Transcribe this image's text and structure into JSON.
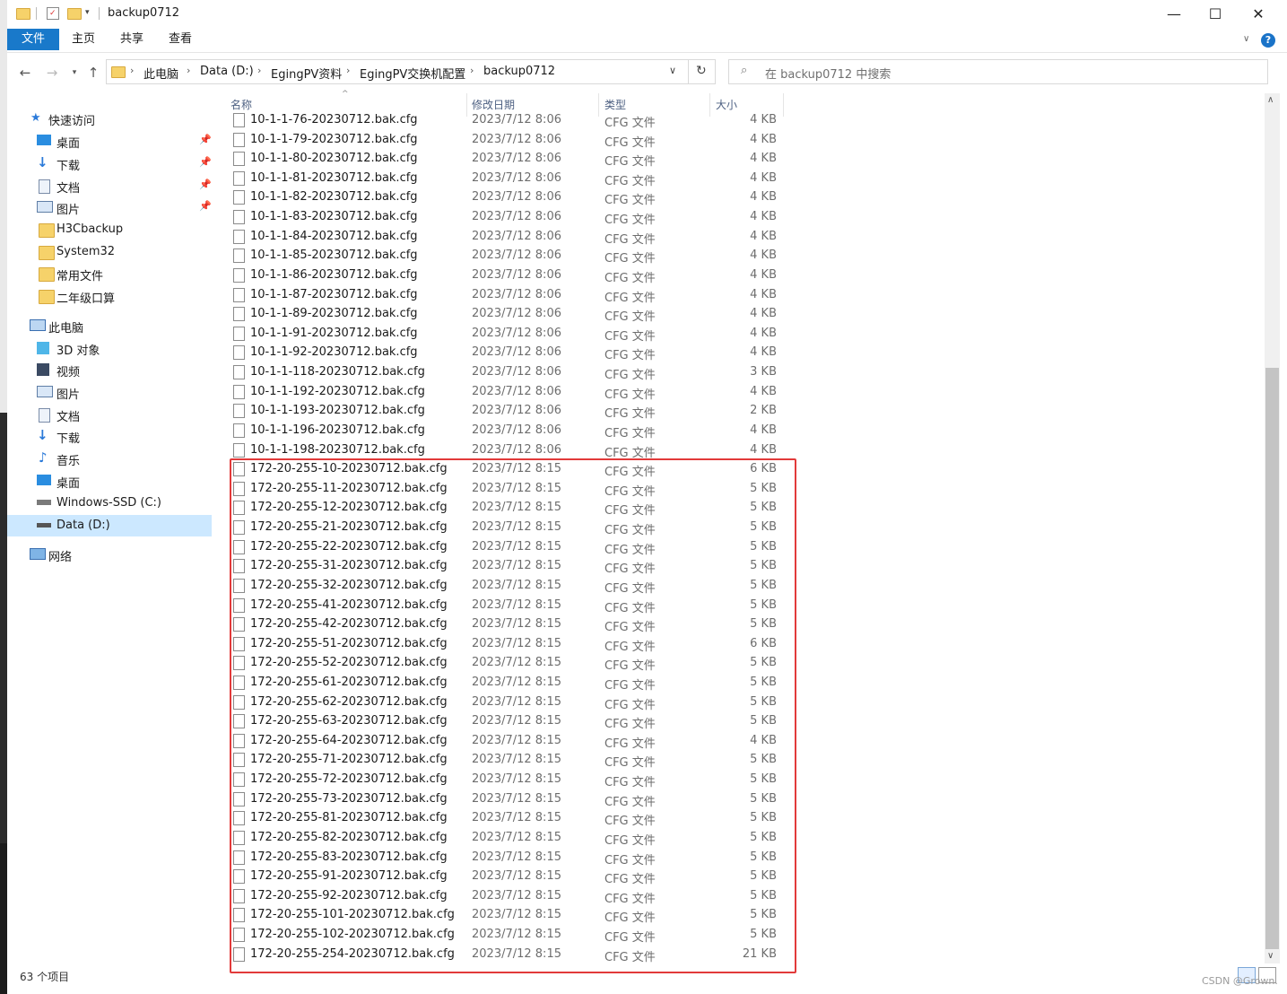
{
  "window": {
    "title": "backup0712",
    "controls": {
      "minimize": "—",
      "maximize": "☐",
      "close": "✕"
    }
  },
  "ribbon": {
    "tabs": [
      "文件",
      "主页",
      "共享",
      "查看"
    ],
    "help": "?"
  },
  "address": {
    "breadcrumb": [
      "此电脑",
      "Data (D:)",
      "EgingPV资料",
      "EgingPV交换机配置",
      "backup0712"
    ],
    "search_placeholder": "在 backup0712 中搜索"
  },
  "nav": {
    "quick_access": "快速访问",
    "quick_items": [
      "桌面",
      "下载",
      "文档",
      "图片",
      "H3Cbackup",
      "System32",
      "常用文件",
      "二年级口算"
    ],
    "this_pc": "此电脑",
    "pc_items": [
      "3D 对象",
      "视频",
      "图片",
      "文档",
      "下载",
      "音乐",
      "桌面",
      "Windows-SSD (C:)",
      "Data (D:)"
    ],
    "network": "网络",
    "selected": "Data (D:)"
  },
  "columns": {
    "name": "名称",
    "date": "修改日期",
    "type": "类型",
    "size": "大小"
  },
  "files": [
    {
      "name": "10-1-1-76-20230712.bak.cfg",
      "date": "2023/7/12 8:06",
      "type": "CFG 文件",
      "size": "4 KB"
    },
    {
      "name": "10-1-1-79-20230712.bak.cfg",
      "date": "2023/7/12 8:06",
      "type": "CFG 文件",
      "size": "4 KB"
    },
    {
      "name": "10-1-1-80-20230712.bak.cfg",
      "date": "2023/7/12 8:06",
      "type": "CFG 文件",
      "size": "4 KB"
    },
    {
      "name": "10-1-1-81-20230712.bak.cfg",
      "date": "2023/7/12 8:06",
      "type": "CFG 文件",
      "size": "4 KB"
    },
    {
      "name": "10-1-1-82-20230712.bak.cfg",
      "date": "2023/7/12 8:06",
      "type": "CFG 文件",
      "size": "4 KB"
    },
    {
      "name": "10-1-1-83-20230712.bak.cfg",
      "date": "2023/7/12 8:06",
      "type": "CFG 文件",
      "size": "4 KB"
    },
    {
      "name": "10-1-1-84-20230712.bak.cfg",
      "date": "2023/7/12 8:06",
      "type": "CFG 文件",
      "size": "4 KB"
    },
    {
      "name": "10-1-1-85-20230712.bak.cfg",
      "date": "2023/7/12 8:06",
      "type": "CFG 文件",
      "size": "4 KB"
    },
    {
      "name": "10-1-1-86-20230712.bak.cfg",
      "date": "2023/7/12 8:06",
      "type": "CFG 文件",
      "size": "4 KB"
    },
    {
      "name": "10-1-1-87-20230712.bak.cfg",
      "date": "2023/7/12 8:06",
      "type": "CFG 文件",
      "size": "4 KB"
    },
    {
      "name": "10-1-1-89-20230712.bak.cfg",
      "date": "2023/7/12 8:06",
      "type": "CFG 文件",
      "size": "4 KB"
    },
    {
      "name": "10-1-1-91-20230712.bak.cfg",
      "date": "2023/7/12 8:06",
      "type": "CFG 文件",
      "size": "4 KB"
    },
    {
      "name": "10-1-1-92-20230712.bak.cfg",
      "date": "2023/7/12 8:06",
      "type": "CFG 文件",
      "size": "4 KB"
    },
    {
      "name": "10-1-1-118-20230712.bak.cfg",
      "date": "2023/7/12 8:06",
      "type": "CFG 文件",
      "size": "3 KB"
    },
    {
      "name": "10-1-1-192-20230712.bak.cfg",
      "date": "2023/7/12 8:06",
      "type": "CFG 文件",
      "size": "4 KB"
    },
    {
      "name": "10-1-1-193-20230712.bak.cfg",
      "date": "2023/7/12 8:06",
      "type": "CFG 文件",
      "size": "2 KB"
    },
    {
      "name": "10-1-1-196-20230712.bak.cfg",
      "date": "2023/7/12 8:06",
      "type": "CFG 文件",
      "size": "4 KB"
    },
    {
      "name": "10-1-1-198-20230712.bak.cfg",
      "date": "2023/7/12 8:06",
      "type": "CFG 文件",
      "size": "4 KB"
    },
    {
      "name": "172-20-255-10-20230712.bak.cfg",
      "date": "2023/7/12 8:15",
      "type": "CFG 文件",
      "size": "6 KB"
    },
    {
      "name": "172-20-255-11-20230712.bak.cfg",
      "date": "2023/7/12 8:15",
      "type": "CFG 文件",
      "size": "5 KB"
    },
    {
      "name": "172-20-255-12-20230712.bak.cfg",
      "date": "2023/7/12 8:15",
      "type": "CFG 文件",
      "size": "5 KB"
    },
    {
      "name": "172-20-255-21-20230712.bak.cfg",
      "date": "2023/7/12 8:15",
      "type": "CFG 文件",
      "size": "5 KB"
    },
    {
      "name": "172-20-255-22-20230712.bak.cfg",
      "date": "2023/7/12 8:15",
      "type": "CFG 文件",
      "size": "5 KB"
    },
    {
      "name": "172-20-255-31-20230712.bak.cfg",
      "date": "2023/7/12 8:15",
      "type": "CFG 文件",
      "size": "5 KB"
    },
    {
      "name": "172-20-255-32-20230712.bak.cfg",
      "date": "2023/7/12 8:15",
      "type": "CFG 文件",
      "size": "5 KB"
    },
    {
      "name": "172-20-255-41-20230712.bak.cfg",
      "date": "2023/7/12 8:15",
      "type": "CFG 文件",
      "size": "5 KB"
    },
    {
      "name": "172-20-255-42-20230712.bak.cfg",
      "date": "2023/7/12 8:15",
      "type": "CFG 文件",
      "size": "5 KB"
    },
    {
      "name": "172-20-255-51-20230712.bak.cfg",
      "date": "2023/7/12 8:15",
      "type": "CFG 文件",
      "size": "6 KB"
    },
    {
      "name": "172-20-255-52-20230712.bak.cfg",
      "date": "2023/7/12 8:15",
      "type": "CFG 文件",
      "size": "5 KB"
    },
    {
      "name": "172-20-255-61-20230712.bak.cfg",
      "date": "2023/7/12 8:15",
      "type": "CFG 文件",
      "size": "5 KB"
    },
    {
      "name": "172-20-255-62-20230712.bak.cfg",
      "date": "2023/7/12 8:15",
      "type": "CFG 文件",
      "size": "5 KB"
    },
    {
      "name": "172-20-255-63-20230712.bak.cfg",
      "date": "2023/7/12 8:15",
      "type": "CFG 文件",
      "size": "5 KB"
    },
    {
      "name": "172-20-255-64-20230712.bak.cfg",
      "date": "2023/7/12 8:15",
      "type": "CFG 文件",
      "size": "4 KB"
    },
    {
      "name": "172-20-255-71-20230712.bak.cfg",
      "date": "2023/7/12 8:15",
      "type": "CFG 文件",
      "size": "5 KB"
    },
    {
      "name": "172-20-255-72-20230712.bak.cfg",
      "date": "2023/7/12 8:15",
      "type": "CFG 文件",
      "size": "5 KB"
    },
    {
      "name": "172-20-255-73-20230712.bak.cfg",
      "date": "2023/7/12 8:15",
      "type": "CFG 文件",
      "size": "5 KB"
    },
    {
      "name": "172-20-255-81-20230712.bak.cfg",
      "date": "2023/7/12 8:15",
      "type": "CFG 文件",
      "size": "5 KB"
    },
    {
      "name": "172-20-255-82-20230712.bak.cfg",
      "date": "2023/7/12 8:15",
      "type": "CFG 文件",
      "size": "5 KB"
    },
    {
      "name": "172-20-255-83-20230712.bak.cfg",
      "date": "2023/7/12 8:15",
      "type": "CFG 文件",
      "size": "5 KB"
    },
    {
      "name": "172-20-255-91-20230712.bak.cfg",
      "date": "2023/7/12 8:15",
      "type": "CFG 文件",
      "size": "5 KB"
    },
    {
      "name": "172-20-255-92-20230712.bak.cfg",
      "date": "2023/7/12 8:15",
      "type": "CFG 文件",
      "size": "5 KB"
    },
    {
      "name": "172-20-255-101-20230712.bak.cfg",
      "date": "2023/7/12 8:15",
      "type": "CFG 文件",
      "size": "5 KB"
    },
    {
      "name": "172-20-255-102-20230712.bak.cfg",
      "date": "2023/7/12 8:15",
      "type": "CFG 文件",
      "size": "5 KB"
    },
    {
      "name": "172-20-255-254-20230712.bak.cfg",
      "date": "2023/7/12 8:15",
      "type": "CFG 文件",
      "size": "21 KB"
    }
  ],
  "status": {
    "count": "63 个项目"
  },
  "watermark": "CSDN @Grown.",
  "colors": {
    "accent": "#1979ca",
    "highlight_box": "#e23a3a",
    "selection": "#cce8ff"
  }
}
